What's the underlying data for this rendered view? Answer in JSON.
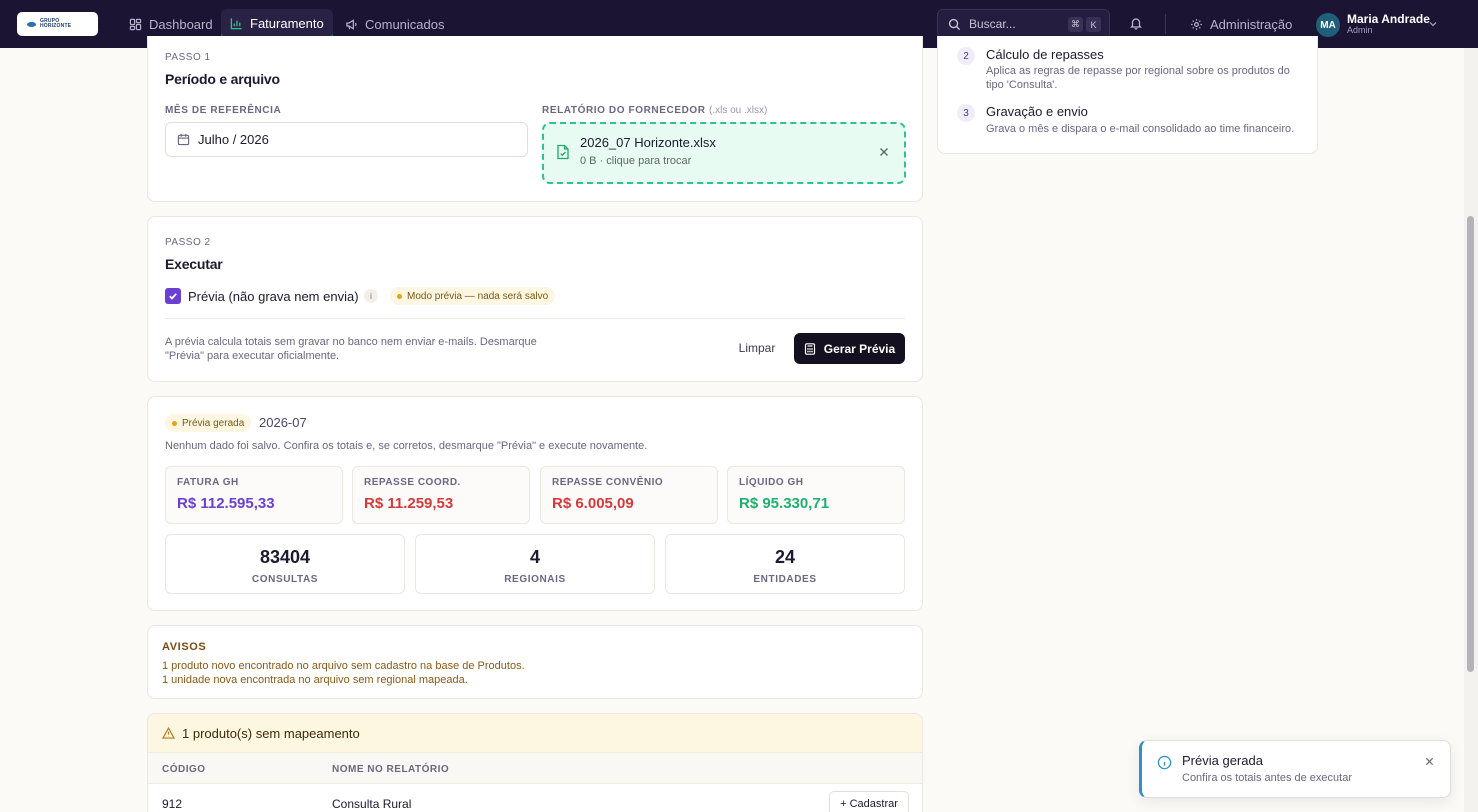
{
  "nav": {
    "logo_line1": "GRUPO",
    "logo_line2": "HORIZONTE",
    "items": [
      {
        "label": "Dashboard",
        "icon": "dashboard-icon"
      },
      {
        "label": "Faturamento",
        "icon": "chart-icon"
      },
      {
        "label": "Comunicados",
        "icon": "megaphone-icon"
      }
    ],
    "search_placeholder": "Buscar...",
    "search_kbd_1": "⌘",
    "search_kbd_2": "K",
    "admin_label": "Administração",
    "user": {
      "initials": "MA",
      "name": "Maria Andrade",
      "role": "Admin"
    }
  },
  "step1": {
    "eyebrow": "PASSO 1",
    "title": "Período e arquivo",
    "month_label": "MÊS DE REFERÊNCIA",
    "month_value": "Julho / 2026",
    "report_label": "RELATÓRIO DO FORNECEDOR",
    "report_hint": "(.xls ou .xlsx)",
    "file_name": "2026_07 Horizonte.xlsx",
    "file_meta": "0 B · clique para trocar"
  },
  "step2": {
    "eyebrow": "PASSO 2",
    "title": "Executar",
    "preview_label": "Prévia (não grava nem envia)",
    "info": "i",
    "mode_pill": "Modo prévia — nada será salvo",
    "help_line1": "A prévia calcula totais sem gravar no banco nem enviar e-mails. Desmarque",
    "help_line2": "\"Prévia\" para executar oficialmente.",
    "clear_button": "Limpar",
    "run_button": "Gerar Prévia"
  },
  "result": {
    "badge": "Prévia gerada",
    "period": "2026-07",
    "note": "Nenhum dado foi salvo. Confira os totais e, se corretos, desmarque \"Prévia\" e execute novamente.",
    "metrics": [
      {
        "label": "FATURA GH",
        "value": "R$ 112.595,33",
        "color": "#6b3fd4"
      },
      {
        "label": "REPASSE COORD.",
        "value": "R$ 11.259,53",
        "color": "#d43a3a"
      },
      {
        "label": "REPASSE CONVÊNIO",
        "value": "R$ 6.005,09",
        "color": "#d43a3a"
      },
      {
        "label": "LÍQUIDO GH",
        "value": "R$ 95.330,71",
        "color": "#1fb06f"
      }
    ],
    "counts": [
      {
        "value": "83404",
        "label": "CONSULTAS"
      },
      {
        "value": "4",
        "label": "REGIONAIS"
      },
      {
        "value": "24",
        "label": "ENTIDADES"
      }
    ]
  },
  "warnings": {
    "title": "AVISOS",
    "lines": [
      "1 produto novo encontrado no arquivo sem cadastro na base de Produtos.",
      "1 unidade nova encontrada no arquivo sem regional mapeada."
    ]
  },
  "unmapped": {
    "title": "1 produto(s) sem mapeamento",
    "col_code": "CÓDIGO",
    "col_name": "NOME NO RELATÓRIO",
    "rows": [
      {
        "code": "912",
        "name": "Consulta Rural",
        "action": "+ Cadastrar"
      }
    ]
  },
  "steps_panel": [
    {
      "num": "2",
      "title": "Cálculo de repasses",
      "desc_line1": "Aplica as regras de repasse por regional sobre os produtos do",
      "desc_line2": "tipo 'Consulta'."
    },
    {
      "num": "3",
      "title": "Gravação e envio",
      "desc_line1": "Grava o mês e dispara o e-mail consolidado ao time financeiro.",
      "desc_line2": ""
    }
  ],
  "toast": {
    "title": "Prévia gerada",
    "message": "Confira os totais antes de executar"
  }
}
